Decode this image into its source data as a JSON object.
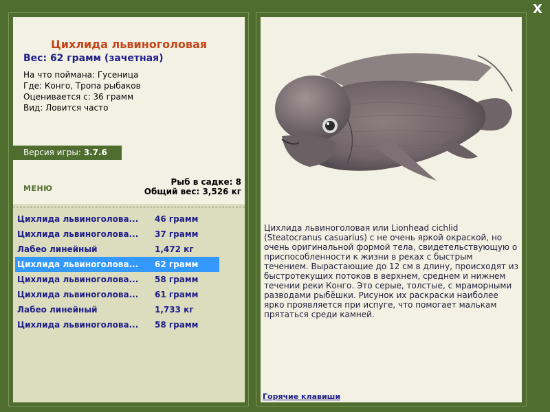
{
  "window": {
    "close_label": "X"
  },
  "fish": {
    "title": "Цихлида львиноголовая",
    "weight_line": "Вес: 62 грамм (зачетная)",
    "details": [
      "На что поймана: Гусеница",
      "Где: Конго, Тропа рыбаков",
      "Оценивается с: 36 грамм",
      "Вид: Ловится часто"
    ],
    "description": "Цихлида львиноголовая или Lionhead cichlid (Steatocranus casuarius) с не очень яркой окраской, но очень оригинальной формой тела, свидетельствующую о приспособленности к жизни в реках с быстрым течением. Вырастающие до 12 см в длину, происходят из быстротекущих потоков в верхнем, среднем и нижнем течении реки Конго. Это серые, толстые, с мраморными разводами рыбёшки. Рисунок их раскраски наиболее ярко проявляется при испуге, что помогает малькам прятаться среди камней."
  },
  "version": {
    "label": "Версия игры:",
    "value": "3.7.6"
  },
  "menu": {
    "label": "МЕНЮ"
  },
  "stats": {
    "fish_in_cage": "Рыб в садке: 8",
    "total_weight": "Общий вес: 3,526 кг"
  },
  "catch_list": [
    {
      "name": "Цихлида львиноголова...",
      "weight": "46 грамм"
    },
    {
      "name": "Цихлида львиноголова...",
      "weight": "37 грамм"
    },
    {
      "name": "Лабео линейный",
      "weight": "1,472 кг"
    },
    {
      "name": "Цихлида львиноголова...",
      "weight": "62 грамм",
      "selected": true
    },
    {
      "name": "Цихлида львиноголова...",
      "weight": "58 грамм"
    },
    {
      "name": "Цихлида львиноголова...",
      "weight": "61 грамм"
    },
    {
      "name": "Лабео линейный",
      "weight": "1,733 кг"
    },
    {
      "name": "Цихлида львиноголова...",
      "weight": "58 грамм"
    }
  ],
  "footer": {
    "hotkeys": "Горячие клавиши"
  },
  "colors": {
    "frame": "#4f6d2e",
    "panel_bg": "#f3f1e3",
    "list_bg": "#dcdcbe",
    "title": "#c5451a",
    "text_blue": "#1e1e8a",
    "selection": "#3399ff"
  },
  "icons": {
    "close": "close-icon",
    "fish_image": "fish-image"
  }
}
